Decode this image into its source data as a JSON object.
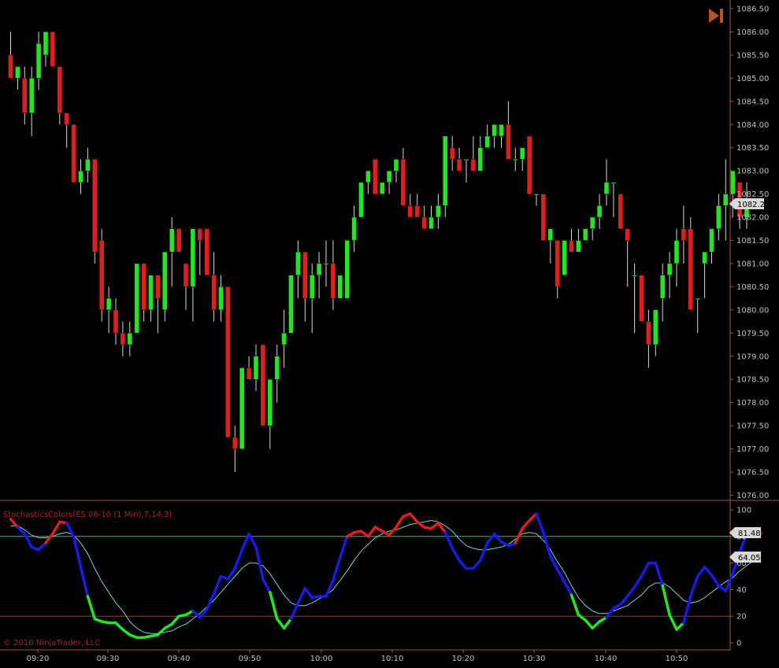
{
  "colors": {
    "background": "#000000",
    "up_candle": "#22e622",
    "down_candle": "#e01e1e",
    "wick": "#d8d8d8",
    "panel_border": "#b0552a",
    "axis_text": "#bfbfbf",
    "k_blue": "#1a1ae6",
    "k_red": "#e01e1e",
    "k_green": "#22e622",
    "d_line": "#66d9e0",
    "upper_line": "#2fbf7a",
    "lower_line": "#c0281e",
    "price_tag_bg": "#d9d9d9",
    "nav_icon": "#b8551e"
  },
  "nav_icon": "skip-to-end-icon",
  "copyright": "© 2010 NinjaTrader, LLC",
  "price_tag": "1082.25",
  "indicator": {
    "label": "StochasticsColors(ES 06-10 (1 Min),7,14,3)",
    "k_tag": "81.48",
    "d_tag": "64.05"
  },
  "chart_data": [
    {
      "type": "candlestick",
      "title": "",
      "y_ticks": [
        "1086.50",
        "1086.00",
        "1085.50",
        "1085.00",
        "1084.50",
        "1084.00",
        "1083.50",
        "1083.00",
        "1082.50",
        "1082.00",
        "1081.50",
        "1081.00",
        "1080.50",
        "1080.00",
        "1079.50",
        "1079.00",
        "1078.50",
        "1078.00",
        "1077.50",
        "1077.00",
        "1076.50",
        "1076.00"
      ],
      "ylim": [
        1075.9,
        1086.6
      ],
      "x_ticks": [
        "09:20",
        "09:30",
        "09:40",
        "09:50",
        "10:00",
        "10:10",
        "10:20",
        "10:30",
        "10:40",
        "10:50"
      ],
      "last_price": 1082.25,
      "candles": [
        [
          1085.5,
          1086.0,
          1085.0,
          1085.0
        ],
        [
          1085.0,
          1085.25,
          1084.75,
          1085.25
        ],
        [
          1085.0,
          1085.25,
          1084.0,
          1084.25
        ],
        [
          1084.25,
          1085.25,
          1083.75,
          1085.0
        ],
        [
          1085.0,
          1086.0,
          1084.75,
          1085.75
        ],
        [
          1085.5,
          1086.0,
          1085.25,
          1086.0
        ],
        [
          1086.0,
          1086.0,
          1085.25,
          1085.25
        ],
        [
          1085.25,
          1085.25,
          1084.0,
          1084.25
        ],
        [
          1084.25,
          1084.25,
          1083.5,
          1084.0
        ],
        [
          1084.0,
          1084.0,
          1082.75,
          1082.75
        ],
        [
          1082.75,
          1083.25,
          1082.5,
          1083.0
        ],
        [
          1083.0,
          1083.5,
          1082.75,
          1083.25
        ],
        [
          1083.25,
          1083.25,
          1081.0,
          1081.25
        ],
        [
          1081.5,
          1081.75,
          1079.75,
          1080.0
        ],
        [
          1080.0,
          1080.5,
          1079.5,
          1080.25
        ],
        [
          1080.0,
          1080.25,
          1079.25,
          1079.5
        ],
        [
          1079.5,
          1079.75,
          1079.0,
          1079.25
        ],
        [
          1079.25,
          1079.75,
          1079.0,
          1079.5
        ],
        [
          1079.5,
          1081.0,
          1079.5,
          1081.0
        ],
        [
          1081.0,
          1081.0,
          1079.75,
          1080.0
        ],
        [
          1080.0,
          1080.75,
          1079.75,
          1080.75
        ],
        [
          1080.75,
          1080.75,
          1079.5,
          1080.25
        ],
        [
          1080.0,
          1081.25,
          1079.75,
          1081.25
        ],
        [
          1081.25,
          1082.0,
          1080.5,
          1081.75
        ],
        [
          1081.75,
          1081.75,
          1081.25,
          1081.25
        ],
        [
          1081.0,
          1081.0,
          1080.0,
          1080.5
        ],
        [
          1080.5,
          1081.75,
          1079.75,
          1081.75
        ],
        [
          1081.75,
          1081.75,
          1080.75,
          1081.5
        ],
        [
          1081.75,
          1081.75,
          1080.75,
          1080.75
        ],
        [
          1080.75,
          1081.25,
          1079.75,
          1080.0
        ],
        [
          1080.0,
          1080.75,
          1079.75,
          1080.5
        ],
        [
          1080.5,
          1080.5,
          1077.25,
          1077.25
        ],
        [
          1077.25,
          1077.5,
          1076.5,
          1077.0
        ],
        [
          1077.0,
          1078.75,
          1077.0,
          1078.75
        ],
        [
          1078.75,
          1079.0,
          1078.5,
          1078.5
        ],
        [
          1078.5,
          1079.25,
          1078.25,
          1079.0
        ],
        [
          1079.25,
          1079.25,
          1077.5,
          1077.5
        ],
        [
          1077.5,
          1078.5,
          1077.0,
          1078.5
        ],
        [
          1078.5,
          1079.25,
          1078.0,
          1079.0
        ],
        [
          1079.25,
          1080.0,
          1078.75,
          1079.5
        ],
        [
          1079.5,
          1080.75,
          1079.5,
          1080.75
        ],
        [
          1080.75,
          1081.5,
          1080.25,
          1081.25
        ],
        [
          1081.25,
          1081.25,
          1079.75,
          1080.25
        ],
        [
          1080.25,
          1081.0,
          1079.5,
          1080.75
        ],
        [
          1080.75,
          1081.25,
          1080.25,
          1081.0
        ],
        [
          1081.0,
          1081.5,
          1080.5,
          1081.0
        ],
        [
          1081.0,
          1081.5,
          1080.0,
          1080.25
        ],
        [
          1080.25,
          1080.75,
          1080.25,
          1080.75
        ],
        [
          1080.25,
          1081.5,
          1080.25,
          1081.5
        ],
        [
          1081.5,
          1082.25,
          1081.25,
          1082.0
        ],
        [
          1082.0,
          1082.75,
          1082.0,
          1082.75
        ],
        [
          1082.75,
          1083.0,
          1082.5,
          1083.0
        ],
        [
          1083.25,
          1083.25,
          1082.5,
          1082.5
        ],
        [
          1082.5,
          1082.75,
          1082.5,
          1082.75
        ],
        [
          1082.75,
          1083.0,
          1082.5,
          1083.0
        ],
        [
          1083.0,
          1083.25,
          1082.75,
          1083.25
        ],
        [
          1083.25,
          1083.5,
          1082.25,
          1082.25
        ],
        [
          1082.25,
          1082.5,
          1082.0,
          1082.0
        ],
        [
          1082.25,
          1082.5,
          1082.0,
          1082.0
        ],
        [
          1082.0,
          1082.25,
          1081.75,
          1081.75
        ],
        [
          1081.75,
          1082.25,
          1081.75,
          1082.0
        ],
        [
          1082.0,
          1082.5,
          1081.75,
          1082.25
        ],
        [
          1082.25,
          1083.75,
          1082.0,
          1083.75
        ],
        [
          1083.5,
          1083.75,
          1083.0,
          1083.25
        ],
        [
          1083.25,
          1083.5,
          1083.0,
          1083.0
        ],
        [
          1083.25,
          1083.25,
          1082.75,
          1083.25
        ],
        [
          1083.25,
          1083.75,
          1083.0,
          1083.0
        ],
        [
          1083.0,
          1083.75,
          1083.0,
          1083.5
        ],
        [
          1083.5,
          1084.0,
          1083.5,
          1083.75
        ],
        [
          1083.75,
          1084.0,
          1083.5,
          1084.0
        ],
        [
          1083.75,
          1084.0,
          1083.5,
          1084.0
        ],
        [
          1084.0,
          1084.5,
          1083.25,
          1083.25
        ],
        [
          1083.25,
          1083.5,
          1083.0,
          1083.25
        ],
        [
          1083.25,
          1083.5,
          1083.0,
          1083.5
        ],
        [
          1083.75,
          1083.75,
          1082.5,
          1082.5
        ],
        [
          1082.5,
          1082.5,
          1082.25,
          1082.5
        ],
        [
          1082.5,
          1082.5,
          1081.5,
          1081.5
        ],
        [
          1081.5,
          1081.75,
          1081.0,
          1081.75
        ],
        [
          1081.5,
          1081.5,
          1080.25,
          1080.5
        ],
        [
          1080.75,
          1081.5,
          1080.75,
          1081.5
        ],
        [
          1081.5,
          1081.75,
          1081.25,
          1081.25
        ],
        [
          1081.25,
          1081.75,
          1081.25,
          1081.5
        ],
        [
          1081.5,
          1081.75,
          1081.5,
          1081.75
        ],
        [
          1081.75,
          1082.0,
          1081.5,
          1082.0
        ],
        [
          1082.0,
          1082.5,
          1081.75,
          1082.25
        ],
        [
          1082.5,
          1083.25,
          1082.25,
          1082.75
        ],
        [
          1082.75,
          1082.75,
          1082.0,
          1082.75
        ],
        [
          1082.5,
          1082.5,
          1081.75,
          1081.75
        ],
        [
          1081.75,
          1081.75,
          1080.5,
          1081.5
        ],
        [
          1080.75,
          1081.0,
          1079.5,
          1080.75
        ],
        [
          1080.75,
          1080.75,
          1079.75,
          1079.75
        ],
        [
          1079.75,
          1080.0,
          1078.75,
          1079.25
        ],
        [
          1079.25,
          1080.0,
          1079.0,
          1080.0
        ],
        [
          1080.25,
          1081.0,
          1079.75,
          1080.75
        ],
        [
          1080.75,
          1081.25,
          1080.25,
          1081.0
        ],
        [
          1081.0,
          1081.75,
          1080.5,
          1081.5
        ],
        [
          1081.75,
          1082.25,
          1081.0,
          1081.5
        ],
        [
          1081.75,
          1082.0,
          1080.75,
          1080.0
        ],
        [
          1080.25,
          1080.25,
          1079.5,
          1080.25
        ],
        [
          1081.0,
          1081.25,
          1080.25,
          1081.25
        ],
        [
          1081.25,
          1081.75,
          1081.0,
          1081.75
        ],
        [
          1081.75,
          1082.5,
          1081.5,
          1082.25
        ],
        [
          1082.25,
          1083.25,
          1081.5,
          1082.5
        ],
        [
          1082.5,
          1083.0,
          1082.0,
          1083.0
        ],
        [
          1082.75,
          1082.75,
          1081.75,
          1082.0
        ],
        [
          1082.0,
          1082.75,
          1081.75,
          1082.25
        ]
      ]
    },
    {
      "type": "line",
      "title": "StochasticsColors(ES 06-10 (1 Min),7,14,3)",
      "ylim": [
        0,
        100
      ],
      "y_ticks": [
        100,
        80,
        60,
        40,
        20,
        0
      ],
      "upper_level": 80,
      "lower_level": 20,
      "series": [
        {
          "name": "K",
          "values": [
            93,
            87,
            82,
            72,
            70,
            75,
            82,
            91,
            90,
            80,
            57,
            35,
            18,
            16,
            15,
            15,
            10,
            6,
            4,
            4,
            5,
            6,
            11,
            14,
            20,
            21,
            24,
            19,
            25,
            37,
            50,
            48,
            56,
            70,
            82,
            72,
            48,
            38,
            18,
            11,
            18,
            30,
            41,
            34,
            35,
            35,
            47,
            64,
            80,
            83,
            84,
            80,
            87,
            84,
            81,
            87,
            95,
            97,
            91,
            87,
            86,
            90,
            83,
            71,
            62,
            56,
            56,
            62,
            75,
            82,
            76,
            73,
            75,
            86,
            92,
            97,
            83,
            65,
            55,
            46,
            36,
            21,
            17,
            11,
            16,
            19,
            26,
            29,
            35,
            42,
            50,
            60,
            60,
            43,
            21,
            10,
            15,
            35,
            50,
            57,
            51,
            43,
            39,
            52,
            68,
            82,
            81,
            82
          ],
          "colors": [
            "red",
            "red",
            "blue",
            "blue",
            "blue",
            "blue",
            "red",
            "red",
            "red",
            "blue",
            "blue",
            "blue",
            "green",
            "green",
            "green",
            "green",
            "green",
            "green",
            "green",
            "green",
            "green",
            "green",
            "green",
            "green",
            "green",
            "green",
            "green",
            "blue",
            "blue",
            "blue",
            "blue",
            "blue",
            "blue",
            "blue",
            "blue",
            "blue",
            "blue",
            "blue",
            "green",
            "green",
            "green",
            "blue",
            "blue",
            "blue",
            "blue",
            "blue",
            "blue",
            "blue",
            "blue",
            "red",
            "red",
            "red",
            "red",
            "red",
            "red",
            "red",
            "red",
            "red",
            "red",
            "red",
            "red",
            "red",
            "red",
            "blue",
            "blue",
            "blue",
            "blue",
            "blue",
            "blue",
            "blue",
            "blue",
            "blue",
            "blue",
            "red",
            "red",
            "red",
            "blue",
            "blue",
            "blue",
            "blue",
            "blue",
            "green",
            "green",
            "green",
            "green",
            "green",
            "blue",
            "blue",
            "blue",
            "blue",
            "blue",
            "blue",
            "blue",
            "blue",
            "green",
            "green",
            "green",
            "blue",
            "blue",
            "blue",
            "blue",
            "blue",
            "blue",
            "blue",
            "blue",
            "blue",
            "red",
            "red"
          ]
        },
        {
          "name": "D",
          "values": [
            88,
            88,
            85,
            81,
            79,
            79,
            80,
            82,
            83,
            81,
            75,
            67,
            56,
            46,
            38,
            30,
            24,
            16,
            11,
            8,
            7,
            7,
            8,
            9,
            12,
            14,
            18,
            22,
            27,
            32,
            38,
            44,
            50,
            56,
            60,
            60,
            58,
            52,
            44,
            36,
            30,
            28,
            28,
            30,
            33,
            36,
            40,
            47,
            54,
            62,
            69,
            74,
            79,
            82,
            84,
            85,
            87,
            89,
            90,
            91,
            92,
            91,
            88,
            84,
            78,
            73,
            71,
            70,
            70,
            71,
            72,
            74,
            78,
            82,
            83,
            82,
            77,
            70,
            61,
            53,
            43,
            34,
            28,
            24,
            22,
            22,
            24,
            26,
            28,
            32,
            36,
            42,
            45,
            45,
            42,
            37,
            32,
            30,
            31,
            34,
            38,
            42,
            46,
            49,
            54,
            58,
            62,
            64
          ]
        }
      ],
      "x_ticks": [
        "09:20",
        "09:30",
        "09:40",
        "09:50",
        "10:00",
        "10:10",
        "10:20",
        "10:30",
        "10:40",
        "10:50"
      ]
    }
  ]
}
